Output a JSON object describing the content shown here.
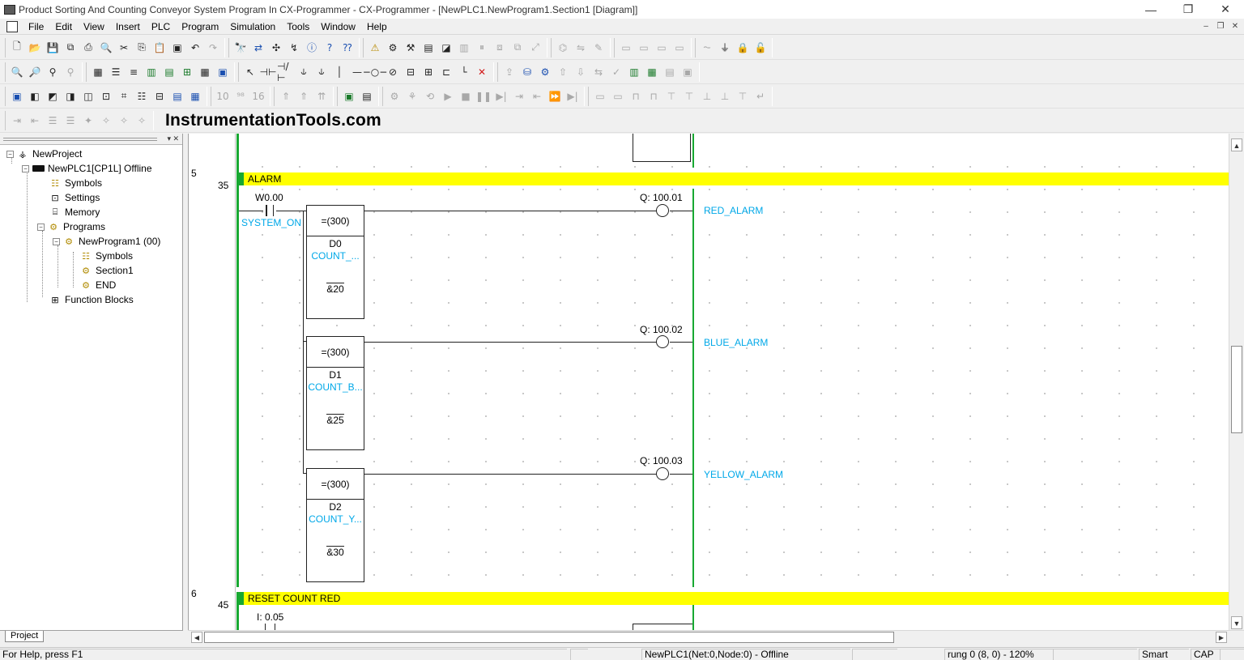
{
  "window": {
    "title": "Product Sorting And Counting Conveyor System Program In CX-Programmer - CX-Programmer - [NewPLC1.NewProgram1.Section1 [Diagram]]",
    "controls": {
      "minimize": "—",
      "restore": "❐",
      "close": "✕"
    }
  },
  "menu": {
    "items": [
      "File",
      "Edit",
      "View",
      "Insert",
      "PLC",
      "Program",
      "Simulation",
      "Tools",
      "Window",
      "Help"
    ],
    "mdi_controls": {
      "minimize": "–",
      "restore": "❐",
      "close": "✕"
    }
  },
  "watermark": "InstrumentationTools.com",
  "project_tree": {
    "items": [
      {
        "label": "NewProject",
        "icon": "project-icon"
      },
      {
        "label": "NewPLC1[CP1L] Offline",
        "icon": "plc-icon"
      },
      {
        "label": "Symbols",
        "icon": "symbols-icon"
      },
      {
        "label": "Settings",
        "icon": "settings-icon"
      },
      {
        "label": "Memory",
        "icon": "memory-icon"
      },
      {
        "label": "Programs",
        "icon": "programs-icon"
      },
      {
        "label": "NewProgram1 (00)",
        "icon": "program-icon"
      },
      {
        "label": "Symbols",
        "icon": "symbols-icon"
      },
      {
        "label": "Section1",
        "icon": "section-icon"
      },
      {
        "label": "END",
        "icon": "section-icon"
      },
      {
        "label": "Function Blocks",
        "icon": "function-blocks-icon"
      }
    ],
    "tab_label": "Project"
  },
  "ladder": {
    "rung5": {
      "rung_number": "5",
      "step": "35",
      "comment": "ALARM",
      "contact": {
        "address": "W0.00",
        "symbol": "SYSTEM_ON"
      },
      "blocks": [
        {
          "op": "=(300)",
          "operand1": "D0",
          "symbol": "COUNT_...",
          "operand2": "&20"
        },
        {
          "op": "=(300)",
          "operand1": "D1",
          "symbol": "COUNT_B...",
          "operand2": "&25"
        },
        {
          "op": "=(300)",
          "operand1": "D2",
          "symbol": "COUNT_Y...",
          "operand2": "&30"
        }
      ],
      "coils": [
        {
          "address": "Q: 100.01",
          "symbol": "RED_ALARM"
        },
        {
          "address": "Q: 100.02",
          "symbol": "BLUE_ALARM"
        },
        {
          "address": "Q: 100.03",
          "symbol": "YELLOW_ALARM"
        }
      ]
    },
    "rung6": {
      "rung_number": "6",
      "step": "45",
      "comment": "RESET COUNT RED",
      "contact": {
        "address": "I: 0.05"
      }
    }
  },
  "status_bar": {
    "help": "For Help, press F1",
    "plc": "NewPLC1(Net:0,Node:0) - Offline",
    "rung": "rung 0 (8, 0)  - 120%",
    "mode": "Smart",
    "caps": "CAP"
  },
  "colors": {
    "rail": "#18a832",
    "comment_bg": "#ffff00",
    "symbol_text": "#00a8e8"
  }
}
